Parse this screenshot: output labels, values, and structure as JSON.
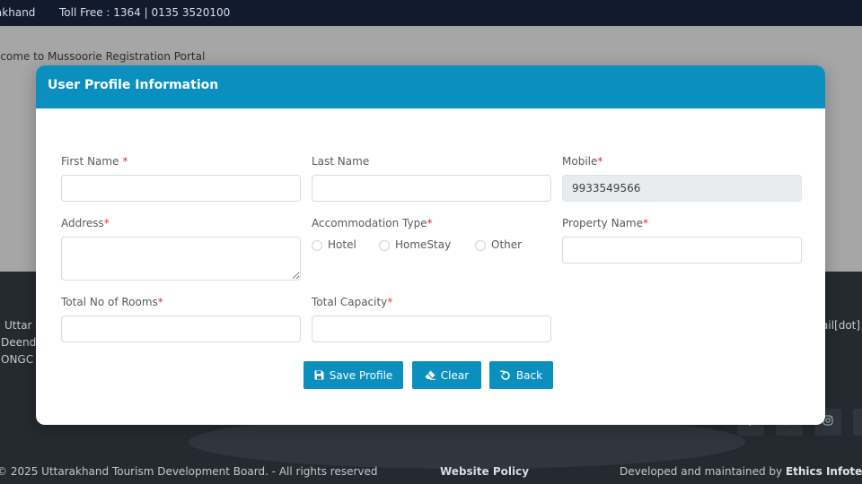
{
  "topbar": {
    "brand": "rakhand",
    "toll_free": "Toll Free : 1364 | 0135 3520100"
  },
  "page": {
    "welcome": "lcome to Mussoorie Registration Portal"
  },
  "footer": {
    "address_lines": [
      "Uttar",
      "Deend",
      "ONGC"
    ],
    "email_fragment": "ail[dot]",
    "social_icons": [
      "facebook-icon",
      "x-icon",
      "instagram-icon",
      "social-icon"
    ],
    "copyright": "© 2025 Uttarakhand Tourism Development Board. - All rights reserved",
    "website_policy": "Website Policy",
    "developed_by_prefix": "Developed and maintained by ",
    "developed_by_company": "Ethics Infote"
  },
  "modal": {
    "title": "User Profile Information",
    "fields": {
      "first_name": {
        "label": "First Name",
        "required_mark": "*",
        "value": ""
      },
      "last_name": {
        "label": "Last Name",
        "value": ""
      },
      "mobile": {
        "label": "Mobile",
        "required_mark": "*",
        "value": "9933549566"
      },
      "address": {
        "label": "Address",
        "required_mark": "*",
        "value": ""
      },
      "accommodation_type": {
        "label": "Accommodation Type",
        "required_mark": "*",
        "options": [
          "Hotel",
          "HomeStay",
          "Other"
        ],
        "selected": null
      },
      "property_name": {
        "label": "Property Name",
        "required_mark": "*",
        "value": ""
      },
      "total_rooms": {
        "label": "Total No of Rooms",
        "required_mark": "*",
        "value": ""
      },
      "total_capacity": {
        "label": "Total Capacity",
        "required_mark": "*",
        "value": ""
      }
    },
    "buttons": {
      "save": "Save Profile",
      "clear": "Clear",
      "back": "Back"
    }
  },
  "colors": {
    "accent": "#0a8fbf",
    "required": "#d9342b",
    "topbar": "#121a2e",
    "footer": "#252a30"
  }
}
